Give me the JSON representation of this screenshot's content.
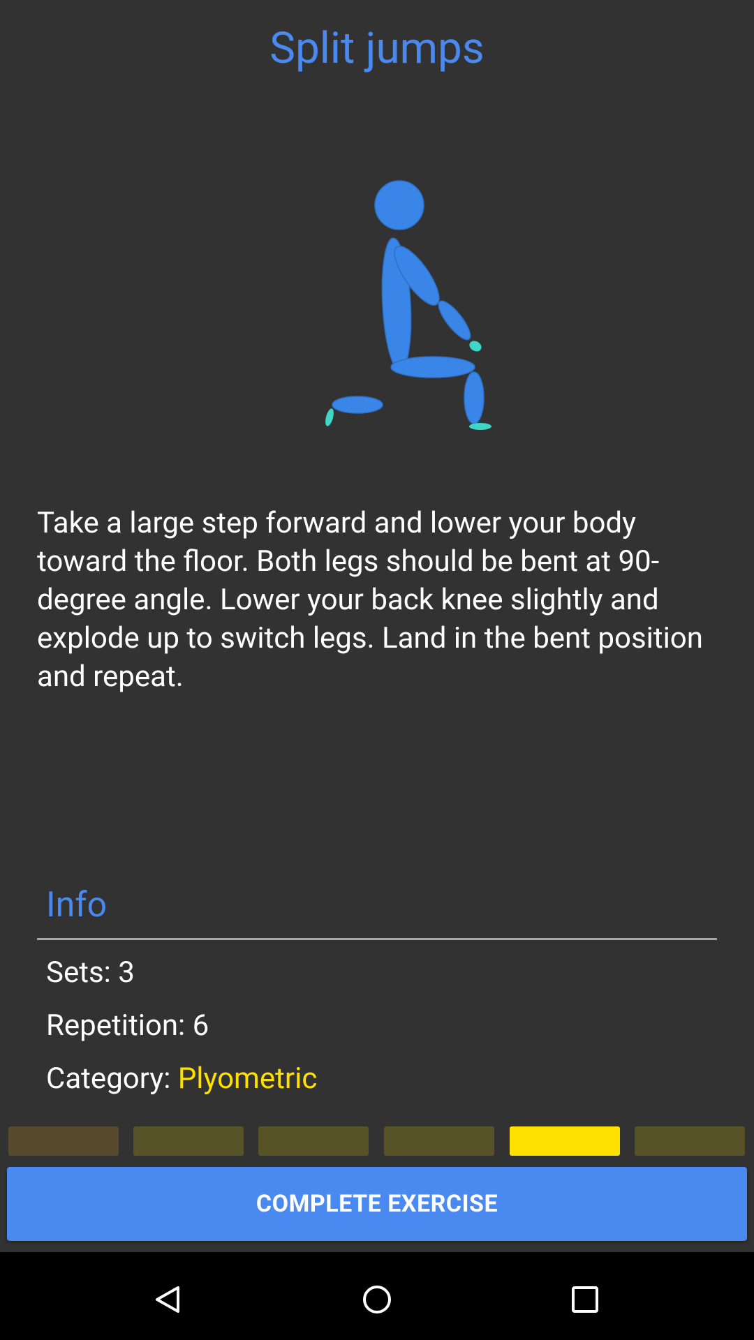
{
  "exercise": {
    "title": "Split jumps",
    "description": "Take a large step forward and lower your body toward the floor. Both legs should be bent at 90-degree angle. Lower your back knee slightly and explode up to switch legs. Land in the bent position and repeat.",
    "illustration_icon": "split-jump-figure-icon"
  },
  "info": {
    "header": "Info",
    "sets_label": "Sets:",
    "sets_value": "3",
    "repetition_label": "Repetition:",
    "repetition_value": "6",
    "category_label": "Category:",
    "category_value": "Plyometric"
  },
  "progress": {
    "segments": [
      {
        "color": "#574a2d",
        "state": "done"
      },
      {
        "color": "#575228",
        "state": "pending"
      },
      {
        "color": "#575228",
        "state": "pending"
      },
      {
        "color": "#575228",
        "state": "pending"
      },
      {
        "color": "#ffe000",
        "state": "current"
      },
      {
        "color": "#575228",
        "state": "pending"
      }
    ]
  },
  "actions": {
    "complete_label": "COMPLETE EXERCISE"
  },
  "navbar": {
    "back_icon": "back-triangle-icon",
    "home_icon": "home-circle-icon",
    "recents_icon": "recents-square-icon"
  },
  "colors": {
    "accent": "#4a89f0",
    "highlight": "#ffe000",
    "background": "#323232",
    "figure_limb": "#3a86e8",
    "figure_extremity": "#3ed6c6"
  }
}
